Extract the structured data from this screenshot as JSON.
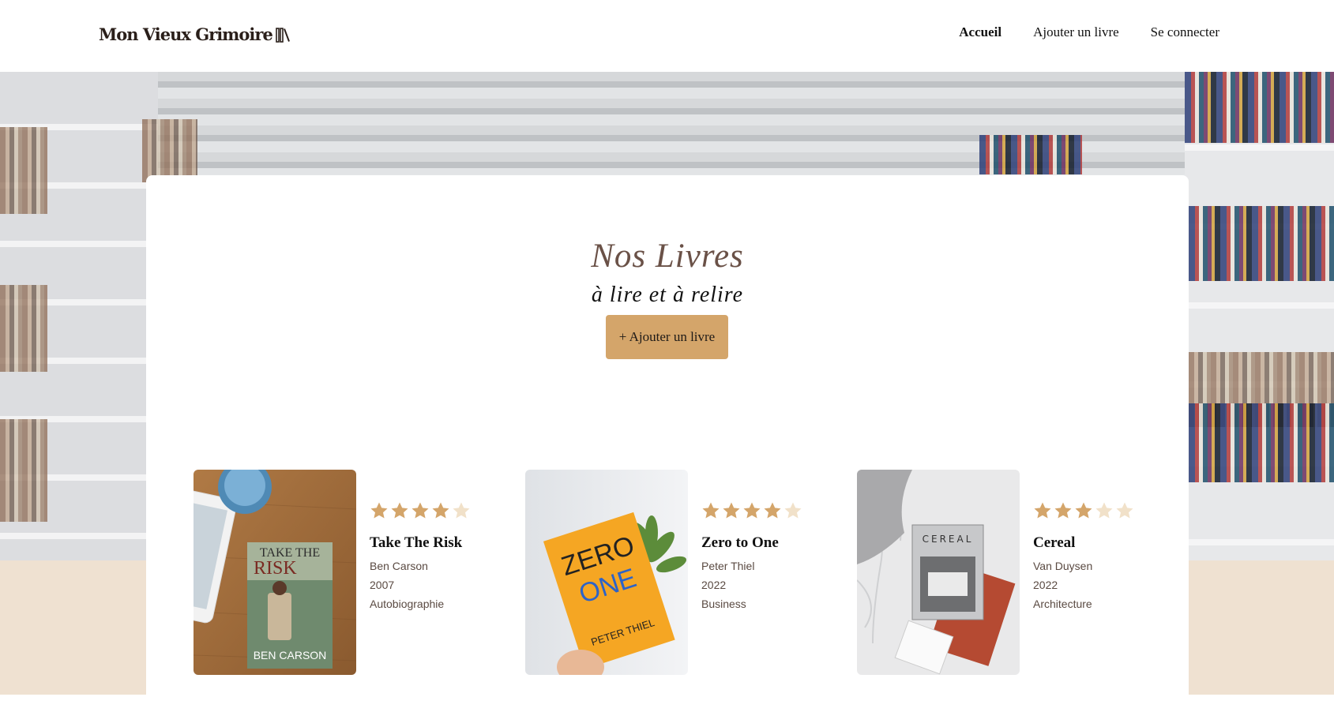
{
  "header": {
    "logo_text": "Mon Vieux Grimoire",
    "nav": [
      "Accueil",
      "Ajouter un livre",
      "Se connecter"
    ]
  },
  "hero": {
    "title": "Nos Livres",
    "subtitle": "à lire et à relire",
    "add_button": "+ Ajouter un livre"
  },
  "colors": {
    "accent": "#d4a56a",
    "title": "#6a5147",
    "beige_band": "#efe1d1",
    "star_filled": "#d4a56a",
    "star_empty": "#f1e1c9"
  },
  "books": [
    {
      "title": "Take The Risk",
      "author": "Ben Carson",
      "year": "2007",
      "genre": "Autobiographie",
      "rating": 4,
      "max_rating": 5,
      "cover_text_top": "TAKE THE",
      "cover_text_main": "RISK",
      "cover_text_bottom": "BEN CARSON"
    },
    {
      "title": "Zero to One",
      "author": "Peter Thiel",
      "year": "2022",
      "genre": "Business",
      "rating": 4,
      "max_rating": 5,
      "cover_text_top": "ZERO",
      "cover_text_main": "ONE",
      "cover_text_bottom": "PETER THIEL"
    },
    {
      "title": "Cereal",
      "author": "Van Duysen",
      "year": "2022",
      "genre": "Architecture",
      "rating": 3,
      "max_rating": 5,
      "cover_text_top": "CEREAL",
      "cover_text_main": "",
      "cover_text_bottom": ""
    }
  ]
}
